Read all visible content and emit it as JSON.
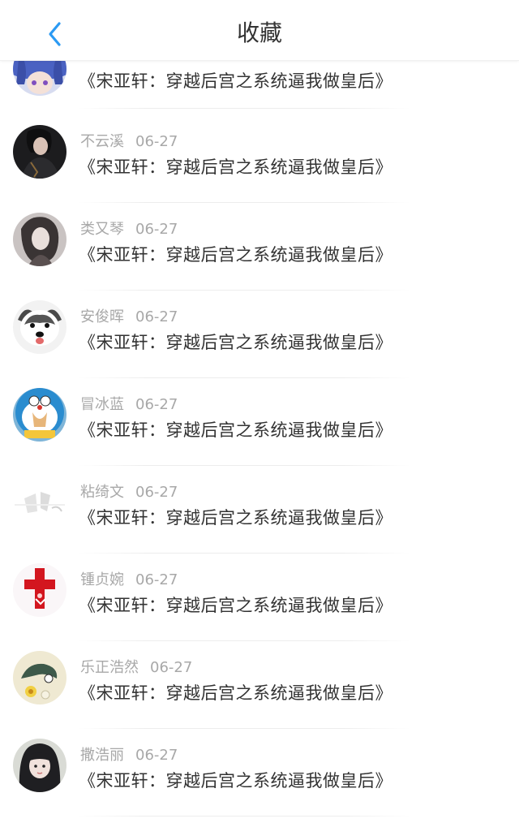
{
  "header": {
    "title": "收藏",
    "back_icon": "chevron-left-icon",
    "accent_color": "#2b9af3"
  },
  "items": [
    {
      "name": "",
      "date": "",
      "text": "《宋亚轩：穿越后宫之系统逼我做皇后》",
      "avatar": "anime-blue-hair"
    },
    {
      "name": "不云溪",
      "date": "06-27",
      "text": "《宋亚轩：穿越后宫之系统逼我做皇后》",
      "avatar": "dark-portrait"
    },
    {
      "name": "类又琴",
      "date": "06-27",
      "text": "《宋亚轩：穿越后宫之系统逼我做皇后》",
      "avatar": "girl-portrait"
    },
    {
      "name": "安俊晖",
      "date": "06-27",
      "text": "《宋亚轩：穿越后宫之系统逼我做皇后》",
      "avatar": "husky-dog"
    },
    {
      "name": "冒冰蓝",
      "date": "06-27",
      "text": "《宋亚轩：穿越后宫之系统逼我做皇后》",
      "avatar": "doraemon-girl"
    },
    {
      "name": "粘绮文",
      "date": "06-27",
      "text": "《宋亚轩：穿越后宫之系统逼我做皇后》",
      "avatar": "faded-sketch"
    },
    {
      "name": "锺贞婉",
      "date": "06-27",
      "text": "《宋亚轩：穿越后宫之系统逼我做皇后》",
      "avatar": "red-cross"
    },
    {
      "name": "乐正浩然",
      "date": "06-27",
      "text": "《宋亚轩：穿越后宫之系统逼我做皇后》",
      "avatar": "flower-cartoon"
    },
    {
      "name": "撒浩丽",
      "date": "06-27",
      "text": "《宋亚轩：穿越后宫之系统逼我做皇后》",
      "avatar": "girl-bangs"
    }
  ]
}
